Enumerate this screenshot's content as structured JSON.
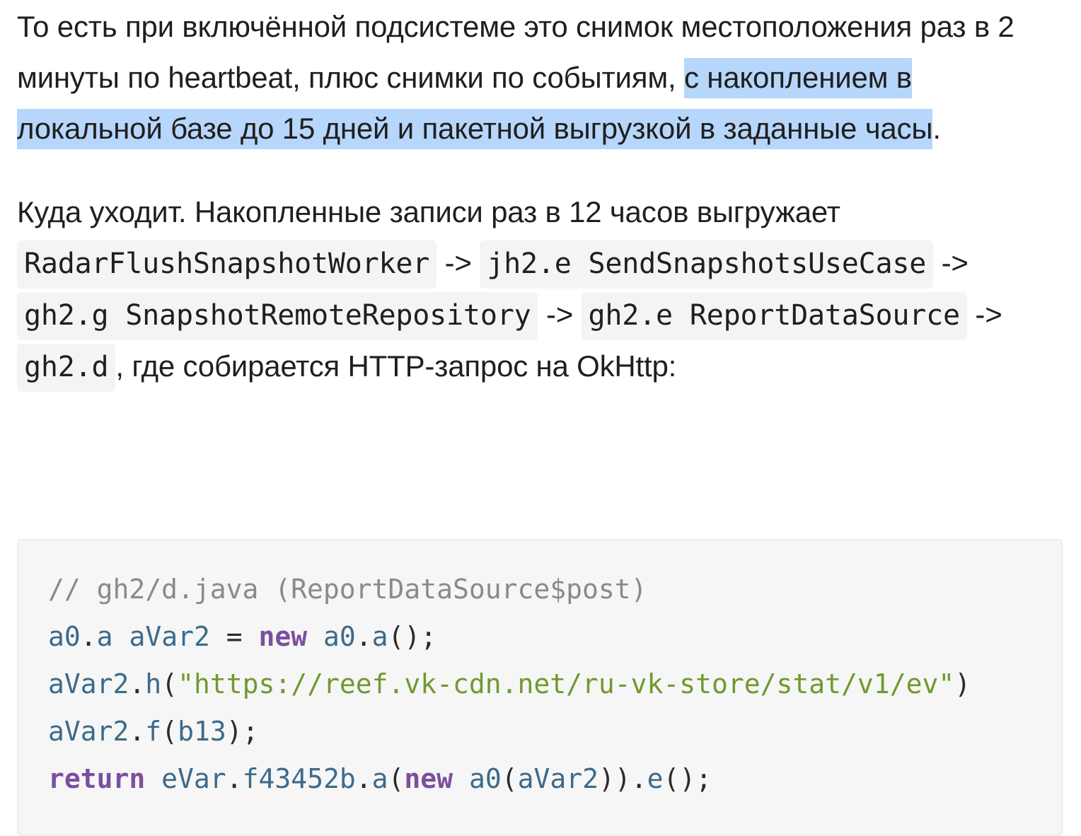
{
  "paragraph_1": {
    "text_before": "То есть при включённой подсистеме это снимок местоположения раз в 2 минуты по heartbeat, плюс снимки по событиям, ",
    "highlighted": "с накоплением в локальной базе до 15 дней и пакетной выгрузкой в заданные часы",
    "text_after": "."
  },
  "paragraph_2": {
    "lead": "Куда уходит. Накопленные записи раз в 12 часов выгружает ",
    "code_1": "RadarFlushSnapshotWorker",
    "arrow_1": " -> ",
    "code_2": "jh2.e SendSnapshotsUseCase",
    "arrow_2": " -> ",
    "code_3": "gh2.g SnapshotRemoteRepository",
    "arrow_3": " -> ",
    "code_4": "gh2.e ReportDataSource",
    "arrow_4": " -> ",
    "code_5": "gh2.d",
    "tail": ", где собирается HTTP-запрос на OkHttp:"
  },
  "code_block": {
    "language": "java",
    "lines": [
      [
        {
          "t": "comment",
          "v": "// gh2/d.java (ReportDataSource$post)"
        }
      ],
      [
        {
          "t": "ident",
          "v": "a0"
        },
        {
          "t": "punct",
          "v": "."
        },
        {
          "t": "ident",
          "v": "a"
        },
        {
          "t": "punct",
          "v": " "
        },
        {
          "t": "ident",
          "v": "aVar2"
        },
        {
          "t": "punct",
          "v": " = "
        },
        {
          "t": "keyword",
          "v": "new"
        },
        {
          "t": "punct",
          "v": " "
        },
        {
          "t": "ident",
          "v": "a0"
        },
        {
          "t": "punct",
          "v": "."
        },
        {
          "t": "ident",
          "v": "a"
        },
        {
          "t": "punct",
          "v": "();"
        }
      ],
      [
        {
          "t": "ident",
          "v": "aVar2"
        },
        {
          "t": "punct",
          "v": "."
        },
        {
          "t": "ident",
          "v": "h"
        },
        {
          "t": "punct",
          "v": "("
        },
        {
          "t": "string",
          "v": "\"https://reef.vk-cdn.net/ru-vk-store/stat/v1/ev\""
        },
        {
          "t": "punct",
          "v": ")"
        }
      ],
      [
        {
          "t": "ident",
          "v": "aVar2"
        },
        {
          "t": "punct",
          "v": "."
        },
        {
          "t": "ident",
          "v": "f"
        },
        {
          "t": "punct",
          "v": "("
        },
        {
          "t": "ident",
          "v": "b13"
        },
        {
          "t": "punct",
          "v": ");"
        }
      ],
      [
        {
          "t": "keyword",
          "v": "return"
        },
        {
          "t": "punct",
          "v": " "
        },
        {
          "t": "ident",
          "v": "eVar"
        },
        {
          "t": "punct",
          "v": "."
        },
        {
          "t": "ident",
          "v": "f43452b"
        },
        {
          "t": "punct",
          "v": "."
        },
        {
          "t": "ident",
          "v": "a"
        },
        {
          "t": "punct",
          "v": "("
        },
        {
          "t": "keyword",
          "v": "new"
        },
        {
          "t": "punct",
          "v": " "
        },
        {
          "t": "ident",
          "v": "a0"
        },
        {
          "t": "punct",
          "v": "("
        },
        {
          "t": "ident",
          "v": "aVar2"
        },
        {
          "t": "punct",
          "v": "))."
        },
        {
          "t": "ident",
          "v": "e"
        },
        {
          "t": "punct",
          "v": "();"
        }
      ]
    ]
  },
  "colors": {
    "selection_highlight": "#b7d6fb",
    "inline_code_bg": "#f4f4f4",
    "code_block_bg": "#f6f6f6",
    "comment": "#8a8a8a",
    "identifier": "#3d6a8a",
    "keyword": "#7b4f9e",
    "string": "#6f9a2e"
  }
}
